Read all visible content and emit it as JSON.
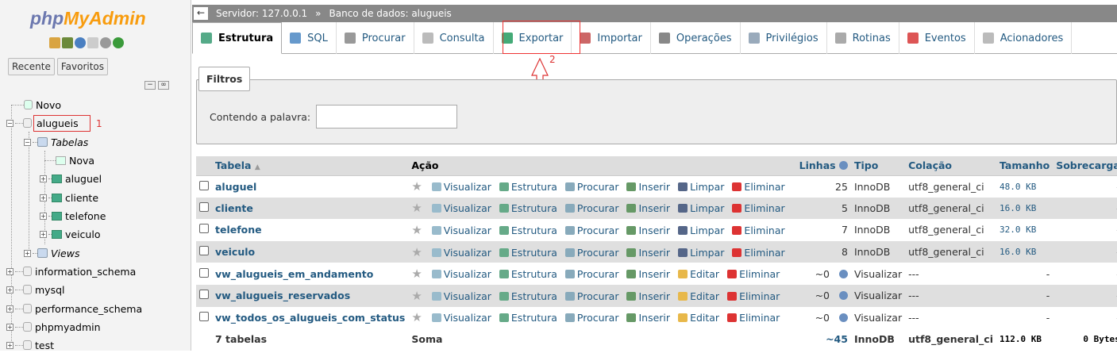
{
  "logo": {
    "php": "php",
    "myadmin": "MyAdmin"
  },
  "left_tabs": [
    "Recente",
    "Favoritos"
  ],
  "tree": {
    "novo": "Novo",
    "db": "alugueis",
    "db_marker": "1",
    "tables_group": "Tabelas",
    "nova": "Nova",
    "tables": [
      "aluguel",
      "cliente",
      "telefone",
      "veiculo"
    ],
    "views_group": "Views",
    "other_dbs": [
      "information_schema",
      "mysql",
      "performance_schema",
      "phpmyadmin",
      "test"
    ]
  },
  "breadcrumb": {
    "server": "Servidor: 127.0.0.1",
    "sep": "»",
    "database": "Banco de dados: alugueis"
  },
  "tabs": [
    {
      "label": "Estrutura",
      "active": true,
      "color": "#5a8"
    },
    {
      "label": "SQL",
      "color": "#69c"
    },
    {
      "label": "Procurar",
      "color": "#999"
    },
    {
      "label": "Consulta",
      "color": "#bbb"
    },
    {
      "label": "Exportar",
      "color": "#4a7"
    },
    {
      "label": "Importar",
      "color": "#c66"
    },
    {
      "label": "Operações",
      "color": "#888"
    },
    {
      "label": "Privilégios",
      "color": "#9ab"
    },
    {
      "label": "Rotinas",
      "color": "#aaa"
    },
    {
      "label": "Eventos",
      "color": "#d55"
    },
    {
      "label": "Acionadores",
      "color": "#bbb"
    }
  ],
  "export_marker": "2",
  "filters": {
    "legend": "Filtros",
    "label": "Contendo a palavra:",
    "value": ""
  },
  "table_headers": {
    "tabela": "Tabela",
    "acao": "Ação",
    "linhas": "Linhas",
    "tipo": "Tipo",
    "colacao": "Colação",
    "tamanho": "Tamanho",
    "sobrecarga": "Sobrecarga"
  },
  "actions": {
    "visualizar": "Visualizar",
    "estrutura": "Estrutura",
    "procurar": "Procurar",
    "inserir": "Inserir",
    "limpar": "Limpar",
    "editar": "Editar",
    "eliminar": "Eliminar"
  },
  "rows": [
    {
      "name": "aluguel",
      "rows": "25",
      "type": "InnoDB",
      "collation": "utf8_general_ci",
      "size": "48.0 KB",
      "overhead": "-",
      "view": false
    },
    {
      "name": "cliente",
      "rows": "5",
      "type": "InnoDB",
      "collation": "utf8_general_ci",
      "size": "16.0 KB",
      "overhead": "-",
      "view": false
    },
    {
      "name": "telefone",
      "rows": "7",
      "type": "InnoDB",
      "collation": "utf8_general_ci",
      "size": "32.0 KB",
      "overhead": "-",
      "view": false
    },
    {
      "name": "veiculo",
      "rows": "8",
      "type": "InnoDB",
      "collation": "utf8_general_ci",
      "size": "16.0 KB",
      "overhead": "-",
      "view": false
    },
    {
      "name": "vw_alugueis_em_andamento",
      "rows": "~0",
      "type": "Visualizar",
      "collation": "---",
      "size": "-",
      "overhead": "-",
      "view": true
    },
    {
      "name": "vw_alugueis_reservados",
      "rows": "~0",
      "type": "Visualizar",
      "collation": "---",
      "size": "-",
      "overhead": "-",
      "view": true
    },
    {
      "name": "vw_todos_os_alugueis_com_status",
      "rows": "~0",
      "type": "Visualizar",
      "collation": "---",
      "size": "-",
      "overhead": "-",
      "view": true
    }
  ],
  "footer": {
    "count": "7 tabelas",
    "soma": "Soma",
    "rows": "~45",
    "type": "InnoDB",
    "collation": "utf8_general_ci",
    "size": "112.0 KB",
    "overhead": "0 Bytes"
  }
}
